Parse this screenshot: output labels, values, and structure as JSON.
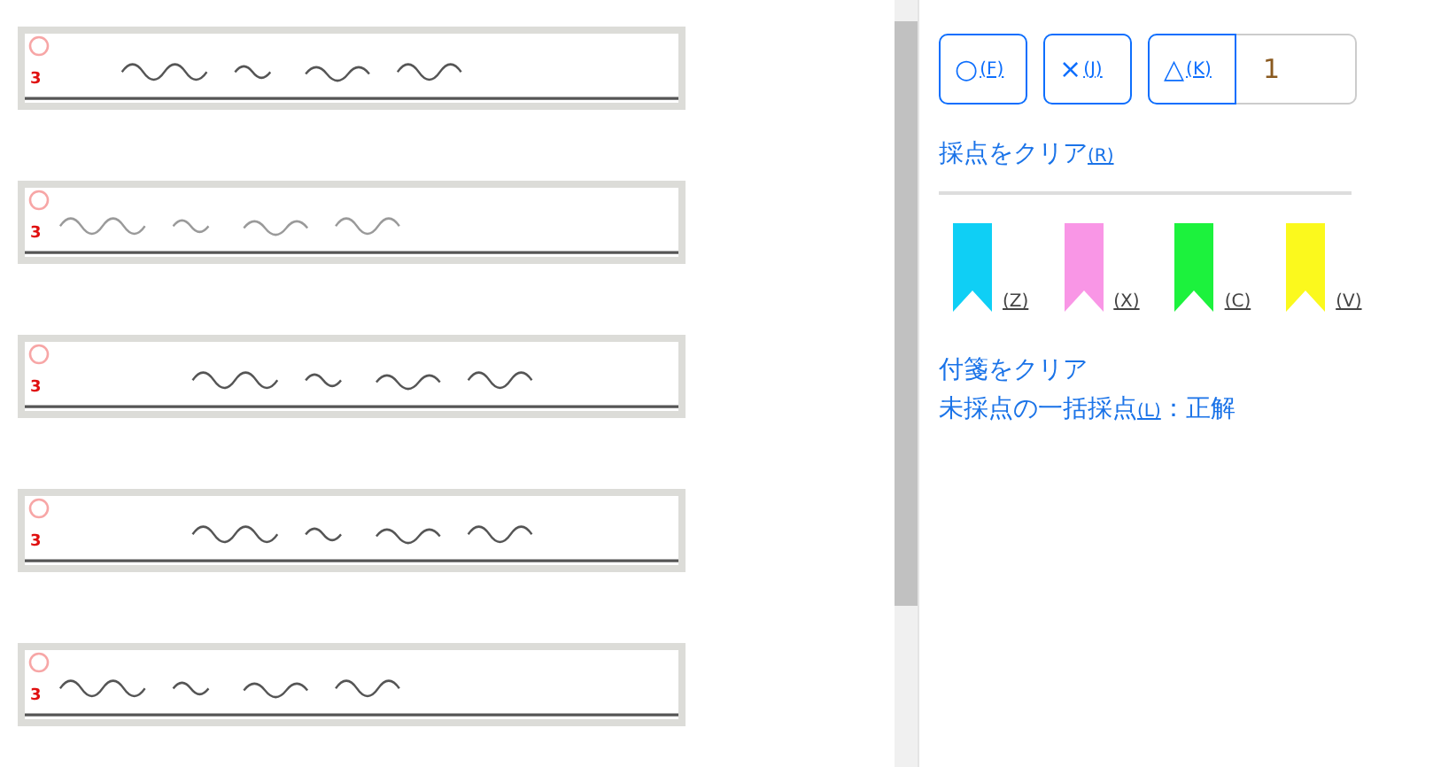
{
  "answers": [
    {
      "marked": true,
      "score": "3"
    },
    {
      "marked": true,
      "score": "3"
    },
    {
      "marked": true,
      "score": "3"
    },
    {
      "marked": true,
      "score": "3"
    },
    {
      "marked": true,
      "score": "3"
    }
  ],
  "grading": {
    "buttons": [
      {
        "label": "○",
        "key": "(F)"
      },
      {
        "label": "×",
        "key": "(J)"
      },
      {
        "label": "△",
        "key": "(K)"
      }
    ],
    "partial_points": "1",
    "clear_link": {
      "label": "採点をクリア",
      "key": "(R)"
    }
  },
  "tags": [
    {
      "color": "#0fcff5",
      "key": "(Z)"
    },
    {
      "color": "#f996e6",
      "key": "(X)"
    },
    {
      "color": "#1cf23d",
      "key": "(C)"
    },
    {
      "color": "#fbf91d",
      "key": "(V)"
    }
  ],
  "clear_tags_link": "付箋をクリア",
  "bulk": {
    "label": "未採点の一括採点",
    "key": "(L)",
    "suffix": "：正解"
  }
}
